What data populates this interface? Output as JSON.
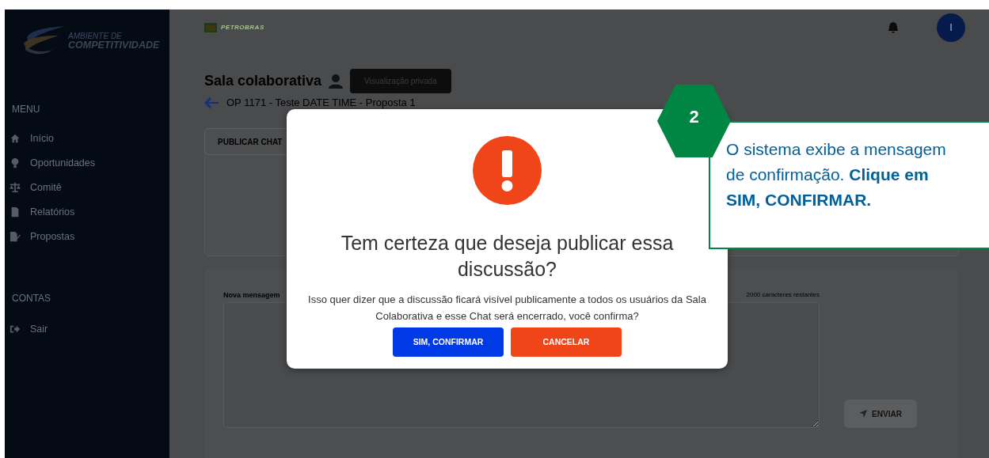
{
  "sidebar": {
    "logo": {
      "line_1": "AMBIENTE DE",
      "line_2": "COMPETITIVIDADE"
    },
    "sections": [
      {
        "title": "MENU",
        "items": [
          {
            "label": "Início"
          },
          {
            "label": "Oportunidades"
          },
          {
            "label": "Comitê"
          },
          {
            "label": "Relatórios"
          },
          {
            "label": "Propostas"
          }
        ]
      },
      {
        "title": "CONTAS",
        "items": [
          {
            "label": "Sair"
          }
        ]
      }
    ]
  },
  "topbar": {
    "brand": "PETROBRAS",
    "avatar": "I"
  },
  "page": {
    "title": "Sala colaborativa",
    "privacy_button": "Visualização privada",
    "breadcrumb": "OP 1171 - Teste DATE TIME - Proposta 1",
    "publish_button": "PUBLICAR CHAT"
  },
  "composer": {
    "label": "Nova mensagem",
    "counter": "2000 caracteres restantes",
    "send_button": "ENVIAR"
  },
  "modal": {
    "title": "Tem certeza que deseja publicar essa discussão?",
    "message": "Isso quer dizer que a discussão ficará visível publicamente a todos os usuários da Sala Colaborativa e esse Chat será encerrado, você confirma?",
    "buttons": [
      {
        "label": "SIM, CONFIRMAR",
        "kind": "confirm"
      },
      {
        "label": "CANCELAR",
        "kind": "cancel"
      }
    ]
  },
  "callout": {
    "step": "2",
    "text": "O sistema exibe a mensagem de confirmação. **Clique em SIM, CONFIRMAR.**"
  }
}
